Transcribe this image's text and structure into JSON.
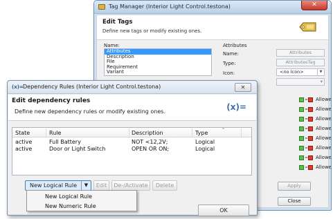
{
  "tag_manager": {
    "title": "Tag Manager (Interior Light Control.testona)",
    "header": "Edit Tags",
    "subheader": "Define new tags or modify existing ones.",
    "name_label": "Name:",
    "attributes_label": "Attributes",
    "tag_list": [
      "Attributes",
      "Description",
      "File",
      "Requirement",
      "Variant"
    ],
    "selected_tag": "Attributes",
    "name_field_label": "Name:",
    "name_value": "Attributes",
    "type_label": "Type:",
    "type_value": "AttributesTag",
    "icon_label": "Icon:",
    "icon_value": "<no Icon>",
    "allowed_label": "Allowed",
    "allowed_rows": 8,
    "apply_label": "Apply",
    "close_label": "Close"
  },
  "dependency_rules": {
    "title": "Dependency Rules (Interior Light Control.testona)",
    "header": "Edit dependency rules",
    "subheader": "Define new dependency rules or modify existing ones.",
    "logo": "(x)=",
    "columns": [
      "State",
      "Rule",
      "Description",
      "Type"
    ],
    "rows": [
      {
        "state": "active",
        "rule": "Full Battery",
        "description": "NOT <12,2V;",
        "type": "Logical"
      },
      {
        "state": "active",
        "rule": "Door or Light Switch",
        "description": "OPEN OR ON;",
        "type": "Logical"
      }
    ],
    "buttons": {
      "new_logical_rule": "New Logical Rule",
      "edit": "Edit",
      "activate": "De-/Activate",
      "delete": "Delete",
      "ok": "OK"
    },
    "menu_items": [
      "New Logical Rule",
      "New Numeric Rule"
    ]
  }
}
